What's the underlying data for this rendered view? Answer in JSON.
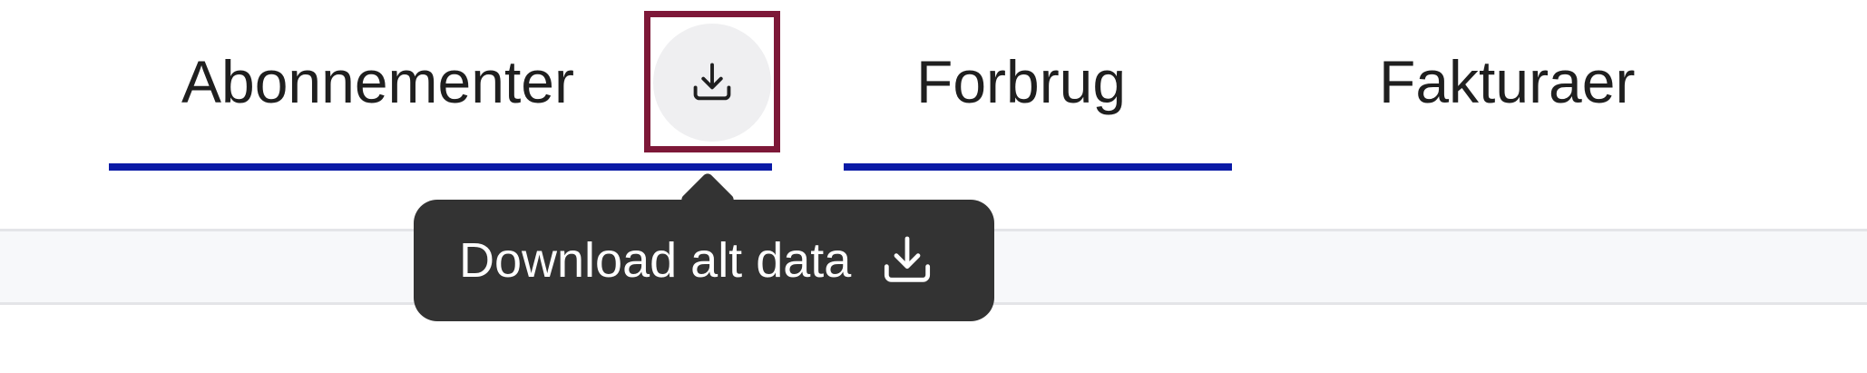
{
  "tabs": [
    {
      "label": "Abonnementer",
      "active": true,
      "has_download": true
    },
    {
      "label": "Forbrug",
      "active": true
    },
    {
      "label": "Fakturaer",
      "active": false
    }
  ],
  "download_button": {
    "icon": "download-icon"
  },
  "tooltip": {
    "text": "Download alt data",
    "icon": "download-icon"
  },
  "colors": {
    "underline": "#0a1aa6",
    "focus_outline": "#7d1838",
    "tooltip_bg": "#333333",
    "button_bg": "#efeff1"
  }
}
